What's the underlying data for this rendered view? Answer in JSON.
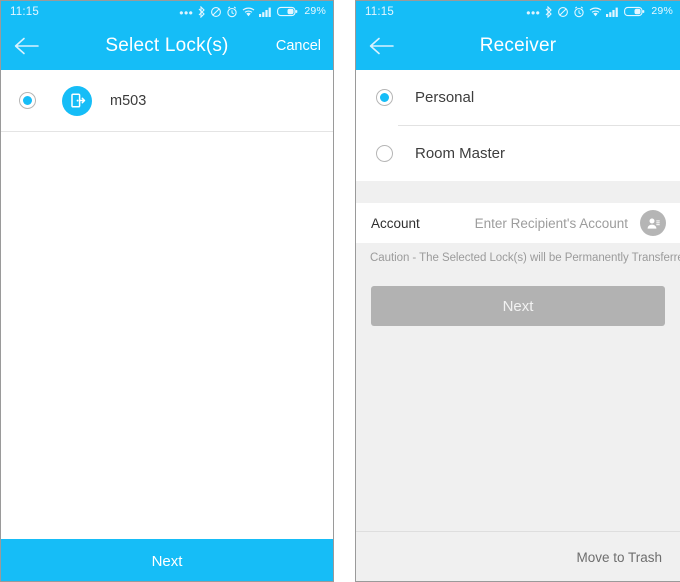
{
  "colors": {
    "accent": "#16bdf7",
    "statusbar": "#15bdf7",
    "panel_bg": "#f0f0f0",
    "disabled_button": "#b2b2b2",
    "text_primary": "#3b3b3b",
    "text_muted": "#9b9b9b"
  },
  "statusbar": {
    "time": "11:15",
    "battery_percent": "29%",
    "icons": [
      "more-dots-icon",
      "bluetooth-icon",
      "mute-icon",
      "alarm-icon",
      "wifi-icon",
      "signal-icon",
      "battery-icon"
    ]
  },
  "left_screen": {
    "title": "Select Lock(s)",
    "back_icon": "back-arrow-icon",
    "cancel_label": "Cancel",
    "locks": [
      {
        "name": "m503",
        "selected": true,
        "icon": "lock-device-icon"
      }
    ],
    "next_label": "Next"
  },
  "right_screen": {
    "title": "Receiver",
    "back_icon": "back-arrow-icon",
    "options": [
      {
        "label": "Personal",
        "selected": true
      },
      {
        "label": "Room Master",
        "selected": false
      }
    ],
    "account": {
      "label": "Account",
      "value": "",
      "placeholder": "Enter Recipient's Account",
      "contact_icon": "contact-picker-icon"
    },
    "caution": "Caution - The Selected Lock(s) will be Permanently Transferred.",
    "next_label": "Next",
    "next_enabled": false,
    "trash_label": "Move to Trash"
  }
}
